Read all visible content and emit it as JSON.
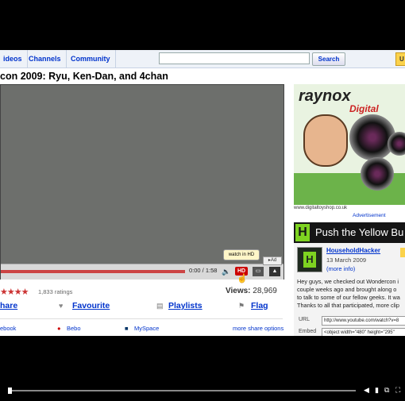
{
  "nav": {
    "items": [
      "ideos",
      "Channels",
      "Community"
    ],
    "search_button": "Search",
    "upload_label": "U"
  },
  "video": {
    "title": "con 2009: Ryu, Ken-Dan, and 4chan",
    "time": "0:00 / 1:58",
    "hd_label": "HD",
    "hd_tooltip": "watch in HD",
    "ad_badge": "Ad",
    "progress_fraction": 0.0
  },
  "stats": {
    "stars": "★★★★",
    "ratings": "1,833 ratings",
    "views_label": "Views:",
    "views": "28,969"
  },
  "actions": {
    "share": "hare",
    "favourite": "Favourite",
    "playlists": "Playlists",
    "flag": "Flag"
  },
  "share_links": {
    "facebook": "ebook",
    "bebo": "Bebo",
    "myspace": "MySpace",
    "more": "more share options"
  },
  "sidebar": {
    "ad_brand": "raynox",
    "ad_subtitle": "Digital",
    "ad_url": "www.digitaltoyshop.co.uk",
    "ad_caption": "Advertisement",
    "banner_text": "Push the Yellow Bu",
    "uploader": "HouseholdHacker",
    "date": "13 March 2009",
    "more_info": "(more info)",
    "description": [
      "Hey guys, we checked out Wondercon i",
      "couple weeks ago and brought along o",
      "to talk to some of our fellow geeks. It wa",
      "Thanks to all that participated, more clip"
    ],
    "url_label": "URL",
    "url_value": "http://www.youtube.com/watch?v=8",
    "embed_label": "Embed",
    "embed_value": "<object width=\"480\" height=\"295\""
  }
}
